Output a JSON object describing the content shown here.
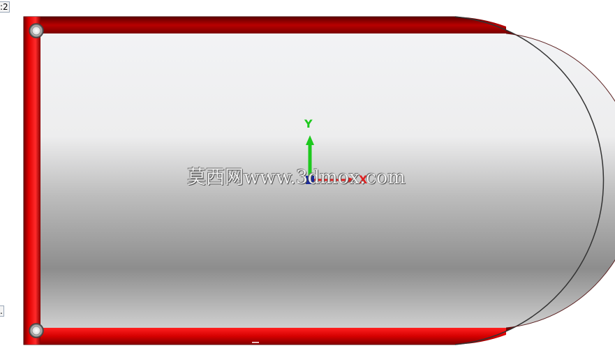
{
  "viewport": {
    "tag_top": ":2",
    "tag_bottom": "."
  },
  "watermark": {
    "text": "莫西网www.3dmox.com"
  },
  "triad": {
    "y_label": "Y",
    "x_label": "X",
    "y_color": "#1dc91d",
    "x_color": "#e02020",
    "origin_color": "#1a2a9a"
  },
  "part": {
    "frame_color": "#d40000",
    "frame_dark": "#7a0000",
    "face_top": "#f3f4f6",
    "face_bottom": "#8a8a8a",
    "edge_color": "#333333"
  },
  "icons": {
    "hole_top_left": "hole-icon",
    "hole_bottom_left": "hole-icon"
  }
}
